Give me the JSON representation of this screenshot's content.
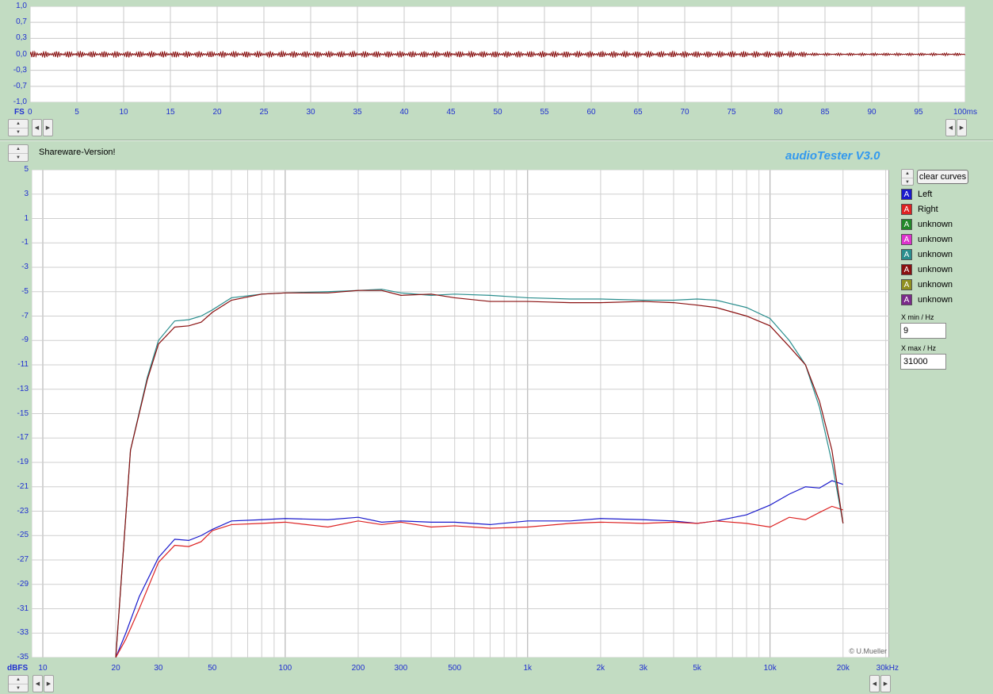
{
  "osc": {
    "y_unit": "FS",
    "y_ticks": [
      "1,0",
      "0,7",
      "0,3",
      "0,0",
      "-0,3",
      "-0,7",
      "-1,0"
    ],
    "x_ticks": [
      "0",
      "5",
      "10",
      "15",
      "20",
      "25",
      "30",
      "35",
      "40",
      "45",
      "50",
      "55",
      "60",
      "65",
      "70",
      "75",
      "80",
      "85",
      "90",
      "95",
      "100ms"
    ]
  },
  "header": {
    "shareware": "Shareware-Version!",
    "app_title": "audioTester  V3.0"
  },
  "main": {
    "y_unit": "dBFS",
    "y_ticks": [
      "5",
      "3",
      "1",
      "-1",
      "-3",
      "-5",
      "-7",
      "-9",
      "-11",
      "-13",
      "-15",
      "-17",
      "-19",
      "-21",
      "-23",
      "-25",
      "-27",
      "-29",
      "-31",
      "-33",
      "-35"
    ],
    "x_tick_labels": [
      {
        "v": 10,
        "t": "10"
      },
      {
        "v": 20,
        "t": "20"
      },
      {
        "v": 30,
        "t": "30"
      },
      {
        "v": 50,
        "t": "50"
      },
      {
        "v": 100,
        "t": "100"
      },
      {
        "v": 200,
        "t": "200"
      },
      {
        "v": 300,
        "t": "300"
      },
      {
        "v": 500,
        "t": "500"
      },
      {
        "v": 1000,
        "t": "1k"
      },
      {
        "v": 2000,
        "t": "2k"
      },
      {
        "v": 3000,
        "t": "3k"
      },
      {
        "v": 5000,
        "t": "5k"
      },
      {
        "v": 10000,
        "t": "10k"
      },
      {
        "v": 20000,
        "t": "20k"
      },
      {
        "v": 30000,
        "t": "30kHz"
      }
    ],
    "copyright": "© U.Mueller"
  },
  "side": {
    "clear_button": "clear curves",
    "legend": [
      {
        "label": "Left",
        "color": "#1a1acc",
        "glyph": "A"
      },
      {
        "label": "Right",
        "color": "#dd2222",
        "glyph": "A"
      },
      {
        "label": "unknown",
        "color": "#22882a",
        "glyph": "A"
      },
      {
        "label": "unknown",
        "color": "#dd33cc",
        "glyph": "A"
      },
      {
        "label": "unknown",
        "color": "#2a8e8e",
        "glyph": "A"
      },
      {
        "label": "unknown",
        "color": "#8a1010",
        "glyph": "A"
      },
      {
        "label": "unknown",
        "color": "#909020",
        "glyph": "A"
      },
      {
        "label": "unknown",
        "color": "#7a2a8a",
        "glyph": "A"
      }
    ],
    "xmin_label": "X min / Hz",
    "xmin_value": "9",
    "xmax_label": "X max / Hz",
    "xmax_value": "31000"
  },
  "chart_data": [
    {
      "type": "line",
      "x_unit": "ms",
      "y_unit": "FS",
      "xlim": [
        0,
        100
      ],
      "ylim": [
        -1.0,
        1.0
      ],
      "grid": true,
      "series": [
        {
          "color": "#8a1010",
          "envelope": [
            [
              0,
              0.07
            ],
            [
              82,
              0.07
            ],
            [
              84,
              0.03
            ],
            [
              100,
              0.03
            ]
          ]
        }
      ]
    },
    {
      "type": "line",
      "x_unit": "Hz",
      "y_unit": "dBFS",
      "x_scale": "log",
      "xlim": [
        9,
        31000
      ],
      "ylim": [
        -35,
        5
      ],
      "grid": true,
      "series": [
        {
          "name": "Left",
          "color": "#1a1acc",
          "points": [
            [
              20,
              -35
            ],
            [
              22,
              -33
            ],
            [
              25,
              -30
            ],
            [
              30,
              -26.8
            ],
            [
              35,
              -25.3
            ],
            [
              40,
              -25.4
            ],
            [
              45,
              -25
            ],
            [
              50,
              -24.5
            ],
            [
              60,
              -23.8
            ],
            [
              80,
              -23.7
            ],
            [
              100,
              -23.6
            ],
            [
              150,
              -23.7
            ],
            [
              200,
              -23.5
            ],
            [
              250,
              -23.9
            ],
            [
              300,
              -23.8
            ],
            [
              400,
              -23.9
            ],
            [
              500,
              -23.9
            ],
            [
              700,
              -24.1
            ],
            [
              1000,
              -23.8
            ],
            [
              1500,
              -23.8
            ],
            [
              2000,
              -23.6
            ],
            [
              3000,
              -23.7
            ],
            [
              4000,
              -23.8
            ],
            [
              5000,
              -24
            ],
            [
              6000,
              -23.8
            ],
            [
              8000,
              -23.3
            ],
            [
              10000,
              -22.5
            ],
            [
              12000,
              -21.6
            ],
            [
              14000,
              -21
            ],
            [
              16000,
              -21.1
            ],
            [
              18000,
              -20.5
            ],
            [
              20000,
              -20.8
            ]
          ]
        },
        {
          "name": "Right",
          "color": "#dd2222",
          "points": [
            [
              20,
              -35
            ],
            [
              22,
              -33.5
            ],
            [
              25,
              -31
            ],
            [
              30,
              -27.2
            ],
            [
              35,
              -25.8
            ],
            [
              40,
              -25.9
            ],
            [
              45,
              -25.5
            ],
            [
              50,
              -24.6
            ],
            [
              60,
              -24.1
            ],
            [
              80,
              -24
            ],
            [
              100,
              -23.9
            ],
            [
              150,
              -24.3
            ],
            [
              200,
              -23.8
            ],
            [
              250,
              -24.1
            ],
            [
              300,
              -23.9
            ],
            [
              400,
              -24.3
            ],
            [
              500,
              -24.2
            ],
            [
              700,
              -24.4
            ],
            [
              1000,
              -24.3
            ],
            [
              1500,
              -24
            ],
            [
              2000,
              -23.9
            ],
            [
              3000,
              -24
            ],
            [
              4000,
              -23.9
            ],
            [
              5000,
              -24
            ],
            [
              6000,
              -23.8
            ],
            [
              8000,
              -24
            ],
            [
              10000,
              -24.3
            ],
            [
              12000,
              -23.5
            ],
            [
              14000,
              -23.7
            ],
            [
              16000,
              -23.1
            ],
            [
              18000,
              -22.6
            ],
            [
              20000,
              -22.9
            ]
          ]
        },
        {
          "name": "",
          "color": "#2a8e8e",
          "points": [
            [
              20,
              -35
            ],
            [
              23,
              -18
            ],
            [
              27,
              -12
            ],
            [
              30,
              -9
            ],
            [
              35,
              -7.4
            ],
            [
              40,
              -7.3
            ],
            [
              45,
              -7
            ],
            [
              50,
              -6.5
            ],
            [
              60,
              -5.5
            ],
            [
              80,
              -5.2
            ],
            [
              100,
              -5.1
            ],
            [
              150,
              -5
            ],
            [
              200,
              -4.9
            ],
            [
              250,
              -4.8
            ],
            [
              300,
              -5.1
            ],
            [
              400,
              -5.3
            ],
            [
              500,
              -5.2
            ],
            [
              700,
              -5.3
            ],
            [
              1000,
              -5.5
            ],
            [
              1500,
              -5.6
            ],
            [
              2000,
              -5.6
            ],
            [
              3000,
              -5.7
            ],
            [
              4000,
              -5.7
            ],
            [
              5000,
              -5.6
            ],
            [
              6000,
              -5.7
            ],
            [
              8000,
              -6.3
            ],
            [
              10000,
              -7.2
            ],
            [
              12000,
              -9
            ],
            [
              14000,
              -11
            ],
            [
              16000,
              -14.5
            ],
            [
              18000,
              -19
            ],
            [
              20000,
              -24
            ]
          ]
        },
        {
          "name": "",
          "color": "#8a1010",
          "points": [
            [
              20,
              -35
            ],
            [
              23,
              -18
            ],
            [
              27,
              -12.2
            ],
            [
              30,
              -9.3
            ],
            [
              35,
              -7.9
            ],
            [
              40,
              -7.8
            ],
            [
              45,
              -7.5
            ],
            [
              50,
              -6.7
            ],
            [
              60,
              -5.7
            ],
            [
              80,
              -5.2
            ],
            [
              100,
              -5.1
            ],
            [
              150,
              -5.1
            ],
            [
              200,
              -4.9
            ],
            [
              250,
              -4.9
            ],
            [
              300,
              -5.3
            ],
            [
              400,
              -5.2
            ],
            [
              500,
              -5.5
            ],
            [
              700,
              -5.8
            ],
            [
              1000,
              -5.8
            ],
            [
              1500,
              -5.9
            ],
            [
              2000,
              -5.9
            ],
            [
              3000,
              -5.8
            ],
            [
              4000,
              -5.9
            ],
            [
              5000,
              -6.1
            ],
            [
              6000,
              -6.3
            ],
            [
              8000,
              -7
            ],
            [
              10000,
              -7.8
            ],
            [
              12000,
              -9.5
            ],
            [
              14000,
              -11
            ],
            [
              16000,
              -14
            ],
            [
              18000,
              -18
            ],
            [
              20000,
              -24
            ]
          ]
        }
      ]
    }
  ]
}
